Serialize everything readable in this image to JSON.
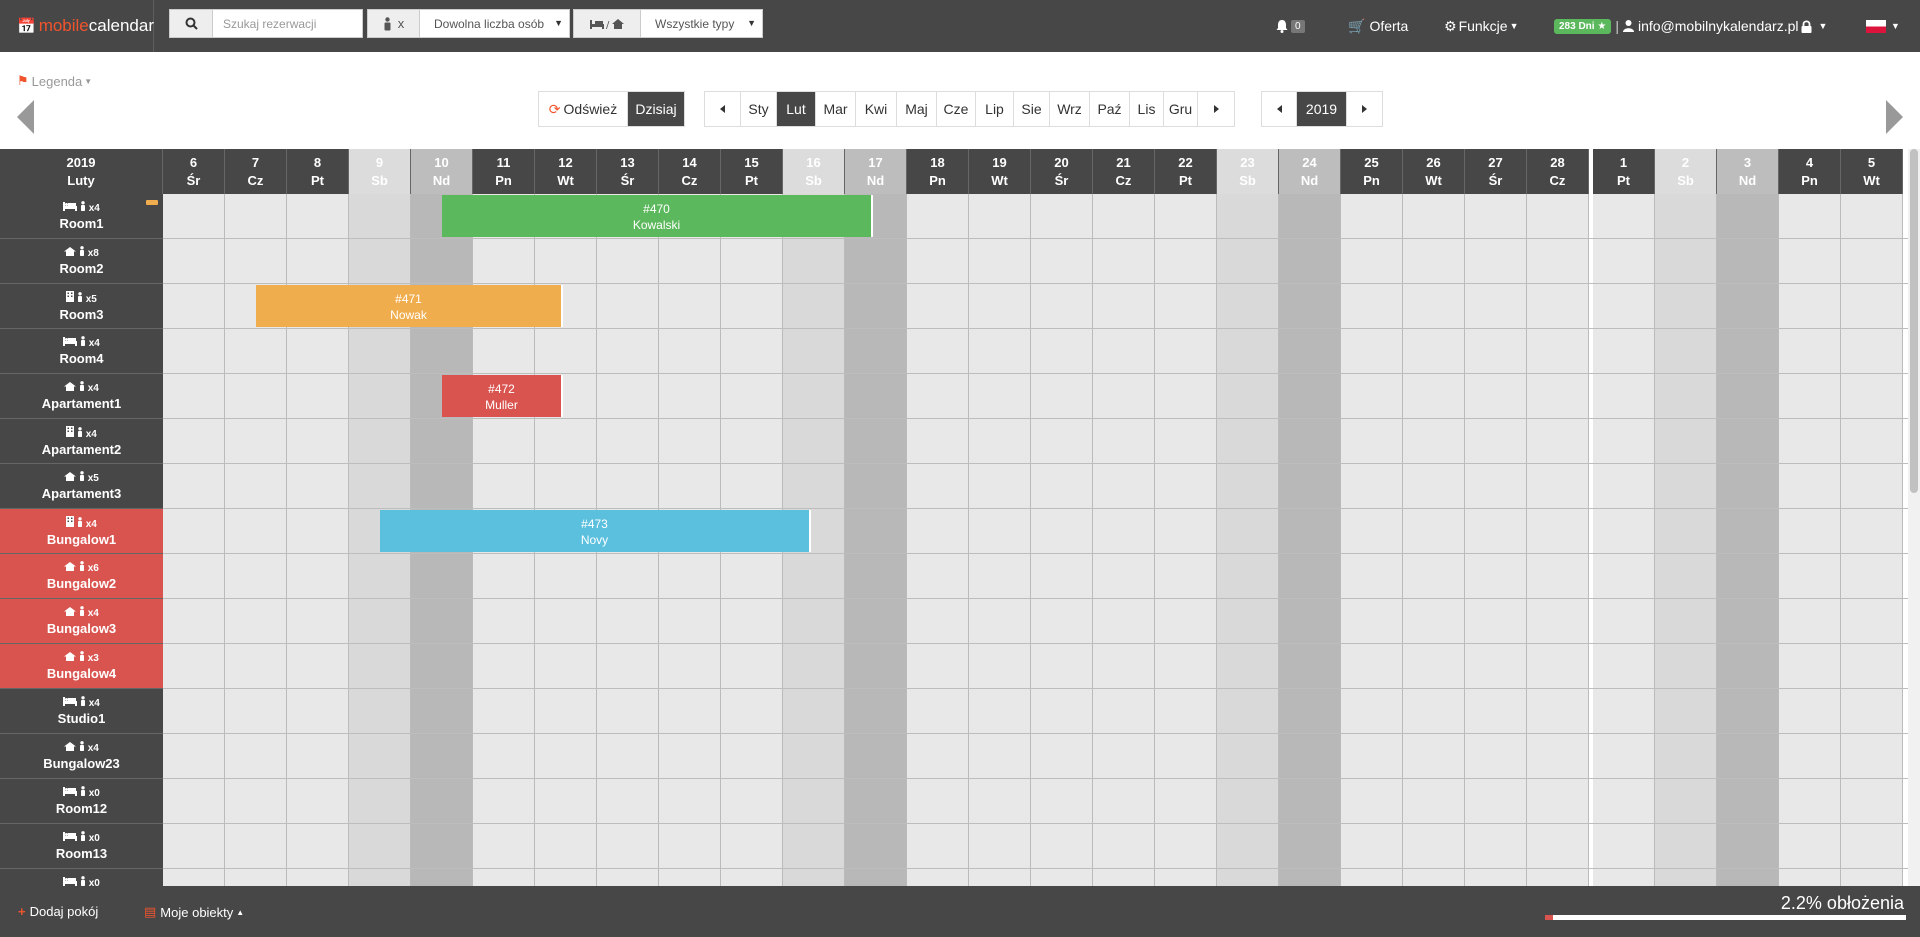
{
  "brand": {
    "part1": "mobile",
    "part2": "calendar"
  },
  "search": {
    "placeholder": "Szukaj rezerwacji"
  },
  "persons": {
    "prefix": "x",
    "value": "Dowolna liczba osób"
  },
  "types": {
    "value": "Wszystkie typy"
  },
  "nav": {
    "notifications_count": "0",
    "offer": "Oferta",
    "functions": "Funkcje",
    "days_badge": "283 Dni",
    "account": "info@mobilnykalendarz.pl"
  },
  "toolbar": {
    "legend": "Legenda",
    "refresh": "Odśwież",
    "today": "Dzisiaj",
    "months": [
      "Sty",
      "Lut",
      "Mar",
      "Kwi",
      "Maj",
      "Cze",
      "Lip",
      "Sie",
      "Wrz",
      "Paź",
      "Lis",
      "Gru"
    ],
    "active_month": "Lut",
    "year": "2019"
  },
  "calendar": {
    "corner_year": "2019",
    "corner_month": "Luty",
    "days": [
      {
        "num": "6",
        "dow": "Śr",
        "type": ""
      },
      {
        "num": "7",
        "dow": "Cz",
        "type": ""
      },
      {
        "num": "8",
        "dow": "Pt",
        "type": ""
      },
      {
        "num": "9",
        "dow": "Sb",
        "type": "sat"
      },
      {
        "num": "10",
        "dow": "Nd",
        "type": "sun"
      },
      {
        "num": "11",
        "dow": "Pn",
        "type": ""
      },
      {
        "num": "12",
        "dow": "Wt",
        "type": ""
      },
      {
        "num": "13",
        "dow": "Śr",
        "type": ""
      },
      {
        "num": "14",
        "dow": "Cz",
        "type": ""
      },
      {
        "num": "15",
        "dow": "Pt",
        "type": ""
      },
      {
        "num": "16",
        "dow": "Sb",
        "type": "sat"
      },
      {
        "num": "17",
        "dow": "Nd",
        "type": "sun"
      },
      {
        "num": "18",
        "dow": "Pn",
        "type": ""
      },
      {
        "num": "19",
        "dow": "Wt",
        "type": ""
      },
      {
        "num": "20",
        "dow": "Śr",
        "type": ""
      },
      {
        "num": "21",
        "dow": "Cz",
        "type": ""
      },
      {
        "num": "22",
        "dow": "Pt",
        "type": ""
      },
      {
        "num": "23",
        "dow": "Sb",
        "type": "sat"
      },
      {
        "num": "24",
        "dow": "Nd",
        "type": "sun"
      },
      {
        "num": "25",
        "dow": "Pn",
        "type": ""
      },
      {
        "num": "26",
        "dow": "Wt",
        "type": ""
      },
      {
        "num": "27",
        "dow": "Śr",
        "type": ""
      },
      {
        "num": "28",
        "dow": "Cz",
        "type": ""
      },
      {
        "num": "1",
        "dow": "Pt",
        "type": "",
        "month_start": true
      },
      {
        "num": "2",
        "dow": "Sb",
        "type": "sat"
      },
      {
        "num": "3",
        "dow": "Nd",
        "type": "sun"
      },
      {
        "num": "4",
        "dow": "Pn",
        "type": ""
      },
      {
        "num": "5",
        "dow": "Wt",
        "type": ""
      }
    ],
    "rooms": [
      {
        "icon": "bed-icon",
        "capacity": "x4",
        "name": "Room1",
        "red": false,
        "marker": true
      },
      {
        "icon": "house-icon",
        "capacity": "x8",
        "name": "Room2",
        "red": false
      },
      {
        "icon": "building-icon",
        "capacity": "x5",
        "name": "Room3",
        "red": false
      },
      {
        "icon": "bed-icon",
        "capacity": "x4",
        "name": "Room4",
        "red": false
      },
      {
        "icon": "house-icon",
        "capacity": "x4",
        "name": "Apartament1",
        "red": false
      },
      {
        "icon": "building-icon",
        "capacity": "x4",
        "name": "Apartament2",
        "red": false
      },
      {
        "icon": "house-icon",
        "capacity": "x5",
        "name": "Apartament3",
        "red": false
      },
      {
        "icon": "building-icon",
        "capacity": "x4",
        "name": "Bungalow1",
        "red": true
      },
      {
        "icon": "house-icon",
        "capacity": "x6",
        "name": "Bungalow2",
        "red": true
      },
      {
        "icon": "house-icon",
        "capacity": "x4",
        "name": "Bungalow3",
        "red": true
      },
      {
        "icon": "house-icon",
        "capacity": "x3",
        "name": "Bungalow4",
        "red": true
      },
      {
        "icon": "bed-icon",
        "capacity": "x4",
        "name": "Studio1",
        "red": false
      },
      {
        "icon": "house-icon",
        "capacity": "x4",
        "name": "Bungalow23",
        "red": false
      },
      {
        "icon": "bed-icon",
        "capacity": "x0",
        "name": "Room12",
        "red": false
      },
      {
        "icon": "bed-icon",
        "capacity": "x0",
        "name": "Room13",
        "red": false
      },
      {
        "icon": "bed-icon",
        "capacity": "x0",
        "name": "",
        "red": false
      }
    ],
    "reservations": [
      {
        "id": "#470",
        "guest": "Kowalski",
        "room": 0,
        "start": "10",
        "end": "17",
        "color": "#5cb85c"
      },
      {
        "id": "#471",
        "guest": "Nowak",
        "room": 2,
        "start": "7",
        "end": "12",
        "color": "#f0ad4e"
      },
      {
        "id": "#472",
        "guest": "Muller",
        "room": 4,
        "start": "10",
        "end": "12",
        "color": "#d9534f"
      },
      {
        "id": "#473",
        "guest": "Novy",
        "room": 7,
        "start": "9",
        "end": "16",
        "color": "#5bc0de"
      }
    ]
  },
  "footer": {
    "add_room": "Dodaj pokój",
    "my_objects": "Moje obiekty",
    "occupancy_label": "2.2% obłożenia",
    "occupancy": 0.022
  }
}
